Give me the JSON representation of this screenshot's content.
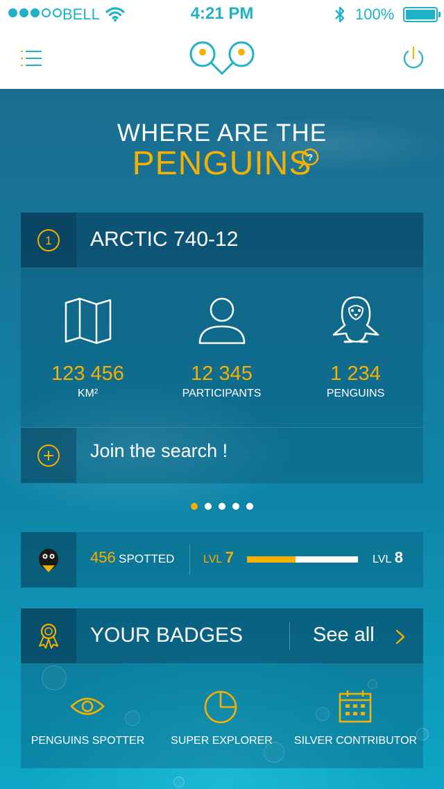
{
  "status_bar": {
    "carrier": "BELL",
    "time": "4:21 PM",
    "battery": "100%",
    "signal_strength": 3
  },
  "nav": {
    "menu_icon": "menu-icon",
    "logo_icon": "binoculars-logo-icon",
    "power_icon": "power-icon"
  },
  "hero": {
    "line1": "WHERE ARE THE",
    "line2": "PENGUINS"
  },
  "search_card": {
    "step": "1",
    "title": "ARCTIC 740-12",
    "stats": [
      {
        "icon": "map-icon",
        "value": "123 456",
        "label": "KM²"
      },
      {
        "icon": "user-icon",
        "value": "12 345",
        "label": "PARTICIPANTS"
      },
      {
        "icon": "penguin-icon",
        "value": "1 234",
        "label": "PENGUINS"
      }
    ],
    "join_label": "Join the search !"
  },
  "pagination": {
    "count": 5,
    "active": 0
  },
  "progress": {
    "spotted_count": "456",
    "spotted_label": "SPOTTED",
    "level_label": "LVL",
    "current_level": "7",
    "next_level": "8",
    "progress_fraction": 0.44,
    "colors": {
      "accent": "#f5b000",
      "track": "#ffffff"
    }
  },
  "badges": {
    "title": "YOUR BADGES",
    "see_all": "See all",
    "items": [
      {
        "icon": "eye-icon",
        "label": "PENGUINS SPOTTER"
      },
      {
        "icon": "pie-chart-icon",
        "label": "SUPER EXPLORER"
      },
      {
        "icon": "calendar-icon",
        "label": "SILVER CONTRIBUTOR"
      }
    ]
  },
  "colors": {
    "accent": "#f5b000",
    "brand": "#1eb2c9"
  }
}
